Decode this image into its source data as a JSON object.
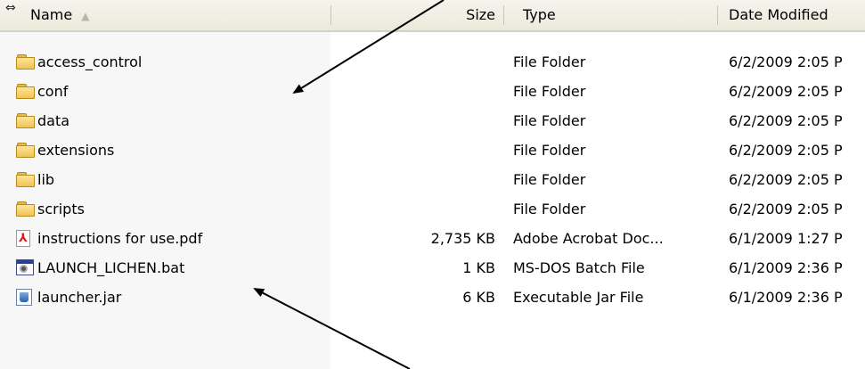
{
  "header": {
    "name": "Name",
    "size": "Size",
    "type": "Type",
    "date_modified": "Date Modified",
    "sort_indicator": "▲"
  },
  "rows": [
    {
      "icon": "folder-icon",
      "name": "access_control",
      "size": "",
      "type": "File Folder",
      "date": "6/2/2009 2:05 P"
    },
    {
      "icon": "folder-icon",
      "name": "conf",
      "size": "",
      "type": "File Folder",
      "date": "6/2/2009 2:05 P"
    },
    {
      "icon": "folder-icon",
      "name": "data",
      "size": "",
      "type": "File Folder",
      "date": "6/2/2009 2:05 P"
    },
    {
      "icon": "folder-icon",
      "name": "extensions",
      "size": "",
      "type": "File Folder",
      "date": "6/2/2009 2:05 P"
    },
    {
      "icon": "folder-icon",
      "name": "lib",
      "size": "",
      "type": "File Folder",
      "date": "6/2/2009 2:05 P"
    },
    {
      "icon": "folder-icon",
      "name": "scripts",
      "size": "",
      "type": "File Folder",
      "date": "6/2/2009 2:05 P"
    },
    {
      "icon": "pdf-icon",
      "name": "instructions for use.pdf",
      "size": "2,735 KB",
      "type": "Adobe Acrobat Doc...",
      "date": "6/1/2009 1:27 P"
    },
    {
      "icon": "batch-file-icon",
      "name": "LAUNCH_LICHEN.bat",
      "size": "1 KB",
      "type": "MS-DOS Batch File",
      "date": "6/1/2009 2:36 P"
    },
    {
      "icon": "jar-file-icon",
      "name": "launcher.jar",
      "size": "6 KB",
      "type": "Executable Jar File",
      "date": "6/1/2009 2:36 P"
    }
  ],
  "annotations": [
    {
      "name": "arrow-to-folders"
    },
    {
      "name": "arrow-to-launch-bat"
    }
  ]
}
